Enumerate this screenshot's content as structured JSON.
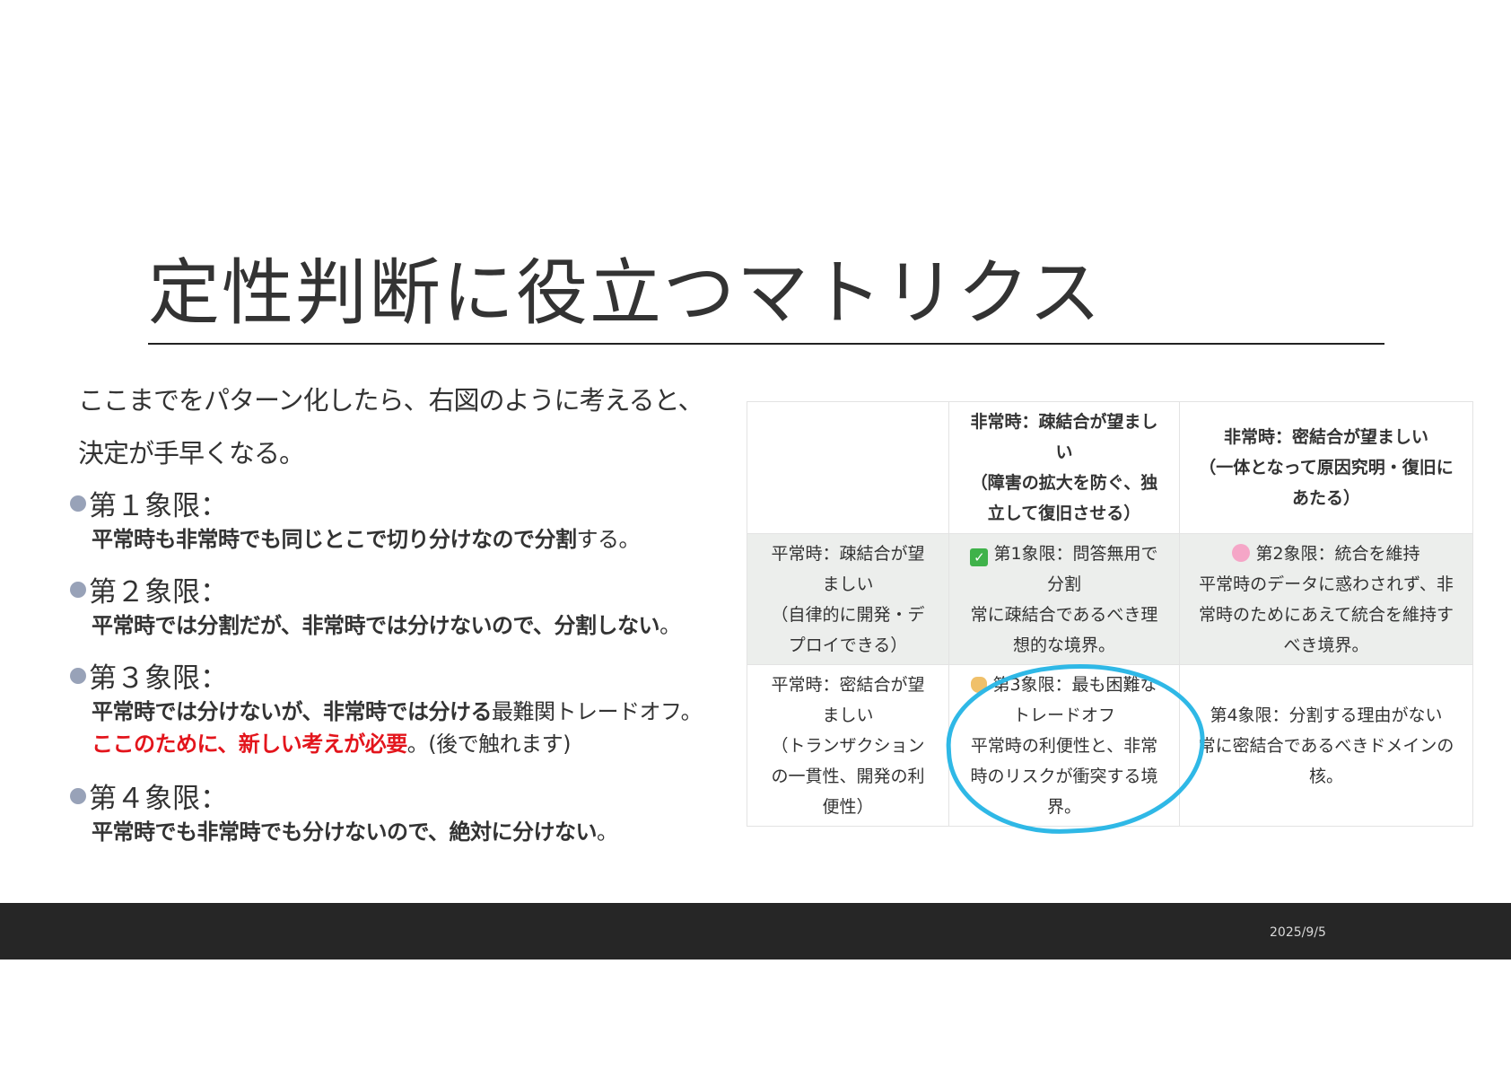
{
  "slide": {
    "title": "定性判断に役立つマトリクス",
    "intro": [
      "ここまでをパターン化したら、右図のように考えると、",
      "決定が手早くなる。"
    ],
    "date": "2025/9/5"
  },
  "quadrants": [
    {
      "head": "第１象限：",
      "bold": "平常時も非常時でも同じとこで切り分けなので分割",
      "tail": "する。"
    },
    {
      "head": "第２象限：",
      "bold": "平常時では分割だが、非常時では分けないので、分割しない",
      "tail": "。"
    },
    {
      "head": "第３象限：",
      "bold": "平常時では分けないが、非常時では分ける",
      "tail": "最難関トレードオフ。",
      "red": "ここのために、新しい考えが必要",
      "tail2": "。(後で触れます)"
    },
    {
      "head": "第４象限：",
      "bold": "平常時でも非常時でも分けないので、絶対に分けない",
      "tail": "。"
    }
  ],
  "matrix": {
    "col_headers": [
      "",
      "非常時：疎結合が望ましい\n（障害の拡大を防ぐ、独立して復旧させる）",
      "非常時：密結合が望ましい\n（一体となって原因究明・復旧にあたる）"
    ],
    "rows": [
      {
        "header": "平常時：疎結合が望ましい\n（自律的に開発・デプロイできる）",
        "q1_title": "第1象限：問答無用で分割",
        "q1_body": "常に疎結合であるべき理想的な境界。",
        "q2_title": "第2象限：統合を維持",
        "q2_body": "平常時のデータに惑わされず、非常時のためにあえて統合を維持すべき境界。"
      },
      {
        "header": "平常時：密結合が望ましい\n（トランザクションの一貫性、開発の利便性）",
        "q3_title": "第3象限：最も困難なトレードオフ",
        "q3_body": "平常時の利便性と、非常時のリスクが衝突する境界。",
        "q4_title": "第4象限：分割する理由がない",
        "q4_body": "常に密結合であるべきドメインの核。"
      }
    ],
    "icons": {
      "q1": "check-mark-icon",
      "q2": "brain-icon",
      "q3": "balance-scale-icon"
    },
    "highlight_color": "#2fb8e6"
  },
  "colors": {
    "accent_red": "#e3151c",
    "footer": "#262626",
    "bullet": "#98a2b8"
  }
}
